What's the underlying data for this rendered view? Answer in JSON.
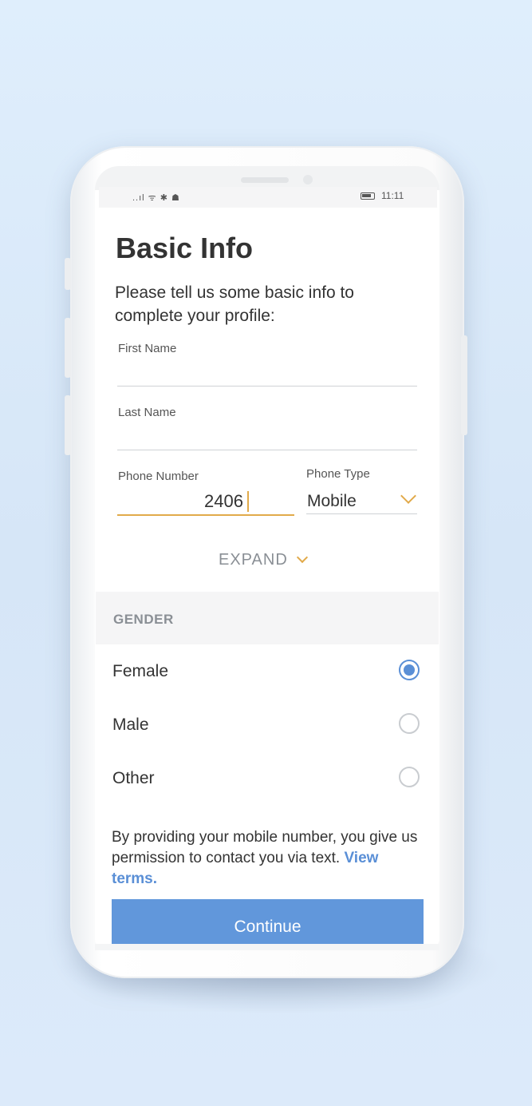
{
  "status_bar": {
    "time": "11:11",
    "icons": "..ıl ᯤ ✱ ☗"
  },
  "form": {
    "title": "Basic Info",
    "subtitle": "Please tell us some basic info to complete your profile:",
    "first_name": {
      "label": "First Name",
      "value": ""
    },
    "last_name": {
      "label": "Last Name",
      "value": ""
    },
    "phone_number": {
      "label": "Phone Number",
      "value": "2406"
    },
    "phone_type": {
      "label": "Phone Type",
      "value": "Mobile",
      "icon": "chevron-down-icon"
    },
    "expand_label": "EXPAND"
  },
  "gender": {
    "heading": "GENDER",
    "options": [
      {
        "label": "Female",
        "selected": true
      },
      {
        "label": "Male",
        "selected": false
      },
      {
        "label": "Other",
        "selected": false
      }
    ]
  },
  "disclaimer": {
    "text": "By providing your mobile number, you give us permission to contact you via text. ",
    "link_label": "View terms."
  },
  "continue_label": "Continue",
  "colors": {
    "accent": "#e1aa4a",
    "primary": "#6197db",
    "link": "#5a8fd6"
  }
}
